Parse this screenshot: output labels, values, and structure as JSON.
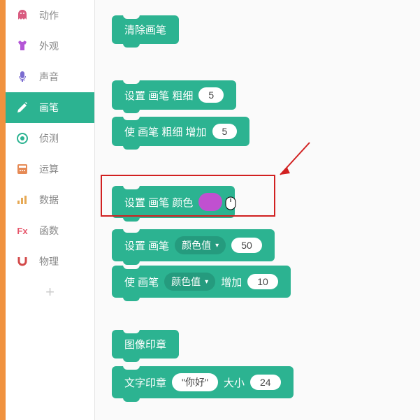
{
  "sidebar": {
    "items": [
      {
        "label": "动作",
        "icon": "motion",
        "color": "#d95c80"
      },
      {
        "label": "外观",
        "icon": "looks",
        "color": "#b355d6"
      },
      {
        "label": "声音",
        "icon": "sound",
        "color": "#7a6cd0"
      },
      {
        "label": "画笔",
        "icon": "pen",
        "color": "#2cb391",
        "active": true
      },
      {
        "label": "侦测",
        "icon": "sensing",
        "color": "#2cb391"
      },
      {
        "label": "运算",
        "icon": "operators",
        "color": "#e68a55"
      },
      {
        "label": "数据",
        "icon": "data",
        "color": "#e6a955"
      },
      {
        "label": "函数",
        "icon": "functions",
        "color": "#e6556a"
      },
      {
        "label": "物理",
        "icon": "physics",
        "color": "#d34a4a"
      }
    ],
    "add": "+"
  },
  "blocks": {
    "clear": "清除画笔",
    "set_size": {
      "label": "设置 画笔 粗细",
      "value": "5"
    },
    "change_size": {
      "label": "使 画笔 粗细 增加",
      "value": "5"
    },
    "set_color": {
      "label": "设置 画笔 颜色",
      "swatch": "#c050d0"
    },
    "set_color_val": {
      "label": "设置 画笔",
      "dropdown": "颜色值",
      "value": "50"
    },
    "change_color_val": {
      "label": "使 画笔",
      "dropdown": "颜色值",
      "label2": "增加",
      "value": "10"
    },
    "stamp_image": "图像印章",
    "stamp_text": {
      "label": "文字印章",
      "text": "\"你好\"",
      "sizelabel": "大小",
      "size": "24"
    }
  }
}
